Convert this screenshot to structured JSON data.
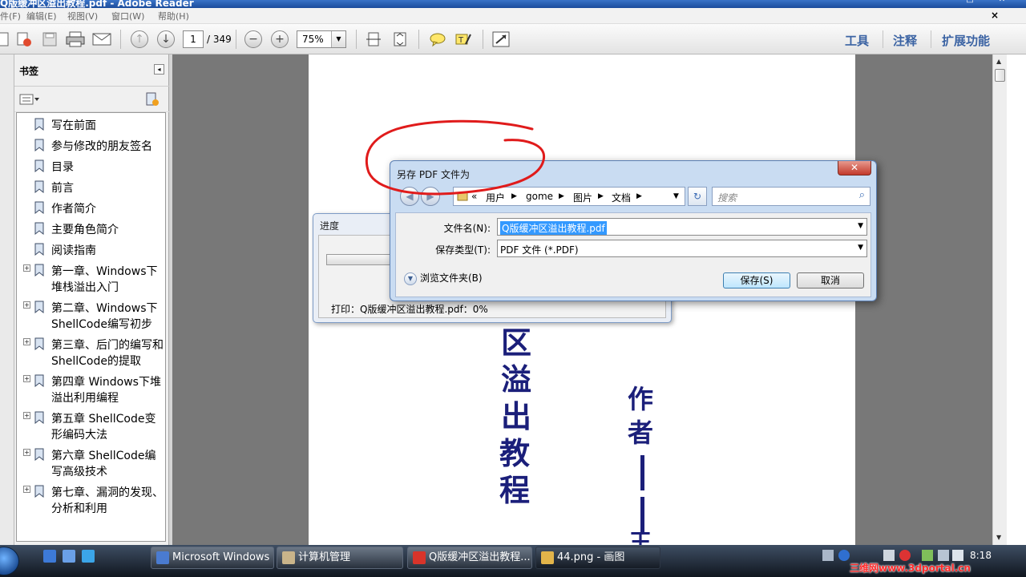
{
  "window": {
    "title": "Q版缓冲区溢出教程.pdf - Adobe Reader",
    "controls": [
      "minimize-icon",
      "maximize-icon",
      "close-icon"
    ]
  },
  "menu": {
    "items": [
      "件(F)",
      "编辑(E)",
      "视图(V)",
      "窗口(W)",
      "帮助(H)"
    ],
    "close_doc": "×"
  },
  "toolbar": {
    "page_current": "1",
    "page_total": "/ 349",
    "zoom": "75%",
    "right_buttons": [
      "工具",
      "注释",
      "扩展功能"
    ]
  },
  "bookmarks": {
    "title": "书签",
    "items": [
      {
        "label": "写在前面",
        "expandable": false
      },
      {
        "label": "参与修改的朋友签名",
        "expandable": false
      },
      {
        "label": "目录",
        "expandable": false
      },
      {
        "label": "前言",
        "expandable": false
      },
      {
        "label": "作者简介",
        "expandable": false
      },
      {
        "label": "主要角色简介",
        "expandable": false
      },
      {
        "label": "阅读指南",
        "expandable": false
      },
      {
        "label": "第一章、Windows下堆栈溢出入门",
        "expandable": true
      },
      {
        "label": "第二章、Windows下ShellCode编写初步",
        "expandable": true
      },
      {
        "label": "第三章、后门的编写和ShellCode的提取",
        "expandable": true
      },
      {
        "label": "第四章 Windows下堆溢出利用编程",
        "expandable": true
      },
      {
        "label": "第五章 ShellCode变形编码大法",
        "expandable": true
      },
      {
        "label": "第六章 ShellCode编写高级技术",
        "expandable": true
      },
      {
        "label": "第七章、漏洞的发现、分析和利用",
        "expandable": true
      }
    ]
  },
  "document": {
    "vertical_title_chars": [
      "区",
      "溢",
      "出",
      "教",
      "程"
    ],
    "author_chars": [
      "作",
      "者"
    ],
    "author_tail": "王"
  },
  "progress_dialog": {
    "title": "进度",
    "status": "打印：Q版缓冲区溢出教程.pdf：0%",
    "progress_percent": 0
  },
  "save_dialog": {
    "title": "另存 PDF 文件为",
    "close": "✕",
    "breadcrumb": [
      "«",
      "用户",
      "gome",
      "图片",
      "文档"
    ],
    "search_placeholder": "搜索",
    "filename_label": "文件名(N):",
    "filename_value": "Q版缓冲区溢出教程.pdf",
    "filetype_label": "保存类型(T):",
    "filetype_value": "PDF 文件 (*.PDF)",
    "browse_label": "浏览文件夹(B)",
    "save_button": "保存(S)",
    "cancel_button": "取消"
  },
  "taskbar": {
    "tasks": [
      {
        "label": "Microsoft Windows",
        "color": "#4a7bd0"
      },
      {
        "label": "计算机管理",
        "color": "#c9b48a"
      },
      {
        "label": "Q版缓冲区溢出教程...",
        "color": "#d8342a"
      },
      {
        "label": "44.png - 画图",
        "color": "#e2b44a"
      }
    ],
    "clock": "8:18",
    "watermark": "三维网www.3dportal.cn"
  },
  "colors": {
    "accent": "#3b63a3",
    "annotation": "#e01b1b",
    "title_text": "#1b1f7a",
    "selection": "#3399ff"
  }
}
